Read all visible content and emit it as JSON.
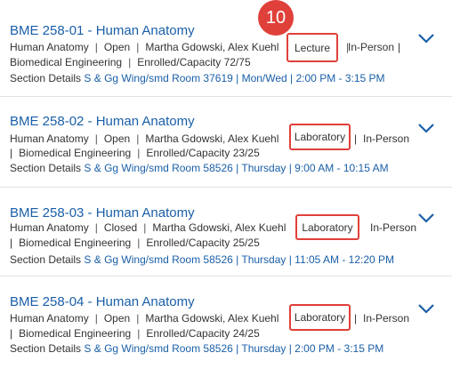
{
  "callout_badge": "10",
  "sections": [
    {
      "title": "BME 258-01 - Human Anatomy",
      "course": "Human Anatomy",
      "status": "Open",
      "instructors": "Martha Gdowski, Alex Kuehl",
      "type": "Lecture",
      "mode": "In-Person",
      "department": "Biomedical Engineering",
      "enrollment": "Enrolled/Capacity 72/75",
      "details_label": "Section Details",
      "details_value": "S & Gg Wing/smd Room 37619 | Mon/Wed | 2:00 PM - 3:15 PM"
    },
    {
      "title": "BME 258-02 - Human Anatomy",
      "course": "Human Anatomy",
      "status": "Open",
      "instructors": "Martha Gdowski, Alex Kuehl",
      "type": "Laboratory",
      "mode": "In-Person",
      "department": "Biomedical Engineering",
      "enrollment": "Enrolled/Capacity 23/25",
      "details_label": "Section Details",
      "details_value": "S & Gg Wing/smd Room 58526 | Thursday | 9:00 AM - 10:15 AM"
    },
    {
      "title": "BME 258-03 - Human Anatomy",
      "course": "Human Anatomy",
      "status": "Closed",
      "instructors": "Martha Gdowski, Alex Kuehl",
      "type": "Laboratory",
      "mode": "In-Person",
      "department": "Biomedical Engineering",
      "enrollment": "Enrolled/Capacity 25/25",
      "details_label": "Section Details",
      "details_value": "S & Gg Wing/smd Room 58526 | Thursday | 11:05 AM - 12:20 PM"
    },
    {
      "title": "BME 258-04 - Human Anatomy",
      "course": "Human Anatomy",
      "status": "Open",
      "instructors": "Martha Gdowski, Alex Kuehl",
      "type": "Laboratory",
      "mode": "In-Person",
      "department": "Biomedical Engineering",
      "enrollment": "Enrolled/Capacity 24/25",
      "details_label": "Section Details",
      "details_value": "S & Gg Wing/smd Room 58526 | Thursday | 2:00 PM - 3:15 PM"
    }
  ]
}
